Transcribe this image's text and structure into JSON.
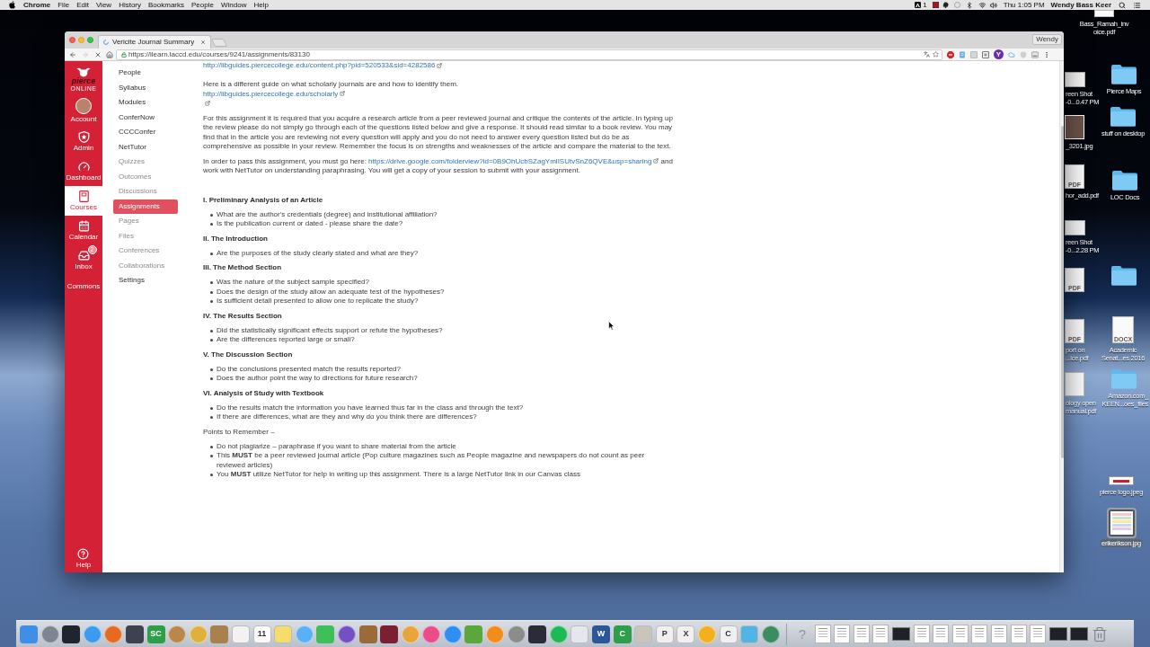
{
  "menu_bar": {
    "app": "Chrome",
    "menus": [
      "File",
      "Edit",
      "View",
      "History",
      "Bookmarks",
      "People",
      "Window",
      "Help"
    ],
    "status_count": "1",
    "clock": "Thu 1:05 PM",
    "user": "Wendy Bass Keer"
  },
  "browser": {
    "tab_title": "Vericite Journal Summary",
    "profile": "Wendy",
    "back": {
      "disabled": false
    },
    "forward": {
      "disabled": true
    },
    "url": "https://ilearn.laccd.edu/courses/9241/assignments/83130",
    "extension_letter": "Y"
  },
  "global_nav": {
    "logo": {
      "name": "pierce",
      "tagline": "ONLINE"
    },
    "items": [
      {
        "kind": "account",
        "label": "Account",
        "selected": false
      },
      {
        "kind": "admin",
        "label": "Admin",
        "selected": false
      },
      {
        "kind": "dashboard",
        "label": "Dashboard",
        "selected": false
      },
      {
        "kind": "courses",
        "label": "Courses",
        "selected": true
      },
      {
        "kind": "calendar",
        "label": "Calendar",
        "selected": false
      },
      {
        "kind": "inbox",
        "label": "Inbox",
        "selected": false,
        "badge": "2"
      },
      {
        "kind": "commons",
        "label": "Commons",
        "selected": false
      }
    ],
    "help": "Help"
  },
  "course_nav": {
    "items": [
      {
        "label": "People",
        "disabled": false,
        "selected": false
      },
      {
        "label": "Syllabus",
        "disabled": false,
        "selected": false
      },
      {
        "label": "Modules",
        "disabled": false,
        "selected": false
      },
      {
        "label": "ConferNow",
        "disabled": false,
        "selected": false
      },
      {
        "label": "CCCConfer",
        "disabled": false,
        "selected": false
      },
      {
        "label": "NetTutor",
        "disabled": false,
        "selected": false
      },
      {
        "label": "Quizzes",
        "disabled": true,
        "selected": false
      },
      {
        "label": "Outcomes",
        "disabled": true,
        "selected": false
      },
      {
        "label": "Discussions",
        "disabled": true,
        "selected": false
      },
      {
        "label": "Assignments",
        "disabled": false,
        "selected": true
      },
      {
        "label": "Pages",
        "disabled": true,
        "selected": false
      },
      {
        "label": "Files",
        "disabled": true,
        "selected": false
      },
      {
        "label": "Conferences",
        "disabled": true,
        "selected": false
      },
      {
        "label": "Collaborations",
        "disabled": true,
        "selected": false
      },
      {
        "label": "Settings",
        "disabled": false,
        "selected": false
      }
    ]
  },
  "content": {
    "blocks": [
      {
        "kind": "link",
        "link": "http://libguides.piercecollege.edu/content.php?pid=520533&sid=4282586"
      },
      {
        "kind": "text",
        "text": "Here is a different guide on what scholarly journals are and how to identify them."
      },
      {
        "kind": "link",
        "link": "http://libguides.piercecollege.edu/scholarly"
      },
      {
        "kind": "icon_line"
      },
      {
        "kind": "paragraph",
        "parts": [
          {
            "text": "For this assignment it is required that you acquire a research article from a peer reviewed journal and critique the contents of the article. In typing up the review please do not simply go through each of the questions listed below and give a response. It should read similar to a book review. You may find that in the article you are reviewing not every question will apply and you do not need to answer every question listed but do be as comprehensive as possible in your review. Remember the focus is on strengths and weaknesses of the article and compare the material to the text."
          }
        ]
      },
      {
        "kind": "paragraph",
        "parts": [
          {
            "text": "In order to pass this assignment, you must go here: "
          },
          {
            "link": "https://drive.google.com/folderview?id=0B9OhUcbSZagYmlISUtvSnZ6QVE&usp=sharing"
          },
          {
            "text": " and work with NetTutor on understanding paraphrasing. You will get a copy of your session to submit with your assignment."
          }
        ]
      },
      {
        "kind": "heading",
        "text": "I. Preliminary Analysis of an Article"
      },
      {
        "kind": "list",
        "items": [
          "What are the author's credentials (degree) and institutional affiliation?",
          "Is the publication current or dated - please share the date?"
        ]
      },
      {
        "kind": "heading",
        "text": "II. The Introduction"
      },
      {
        "kind": "list",
        "items": [
          "Are the purposes of the study clearly stated and what are they?"
        ]
      },
      {
        "kind": "heading",
        "text": "III. The Method Section"
      },
      {
        "kind": "list",
        "items": [
          "Was the nature of the subject sample specified?",
          "Does the design of the study allow an adequate test of the hypotheses?",
          "Is sufficient detail presented to allow one to replicate the study?"
        ]
      },
      {
        "kind": "heading",
        "text": "IV. The Results Section"
      },
      {
        "kind": "list",
        "items": [
          "Did the statistically significant effects support or refute the hypotheses?",
          "Are the differences reported large or small?"
        ]
      },
      {
        "kind": "heading",
        "text": "V. The Discussion Section"
      },
      {
        "kind": "list",
        "items": [
          "Do the conclusions presented match the results reported?",
          "Does the author point the way to directions for future research?"
        ]
      },
      {
        "kind": "heading",
        "text": "VI. Analysis of Study with Textbook"
      },
      {
        "kind": "list",
        "items": [
          "Do the results match the information you have learned thus far in the class and through the text?",
          "If there are differences, what are they and why do you think there are differences?"
        ]
      },
      {
        "kind": "paragraph",
        "parts": [
          {
            "text": "Points to Remember –"
          }
        ]
      },
      {
        "kind": "list",
        "items": [
          "Do not plagiarize – paraphrase if you want to share material from the article",
          "This **MUST** be a peer reviewed journal article (Pop culture magazines such as People magazine and newspapers do not count as peer reviewed articles)",
          "You **MUST** utilize NetTutor for help in writing up this assignment. There is a large NetTutor link in our Canvas class"
        ]
      }
    ]
  },
  "desktop_icons": [
    {
      "kind": "pdf",
      "label": [
        "Bass_Ramah_inv",
        "oice.pdf"
      ],
      "selected": false
    },
    {
      "kind": "screenshot",
      "label": [
        "reen Shot",
        "-0...0.47 PM"
      ],
      "selected": false
    },
    {
      "kind": "folder",
      "label": [
        "Pierce Maps"
      ],
      "selected": false
    },
    {
      "kind": "photo",
      "label": [
        "_3201.jpg"
      ],
      "selected": false
    },
    {
      "kind": "folder",
      "label": [
        "stuff on desktop"
      ],
      "selected": false
    },
    {
      "kind": "pdf",
      "tag": "PDF",
      "label": [
        "hor_add.pdf"
      ],
      "selected": false
    },
    {
      "kind": "folder",
      "label": [
        "LOC Docs"
      ],
      "selected": false
    },
    {
      "kind": "screenshot",
      "label": [
        "reen Shot",
        "-0...2.28 PM"
      ],
      "selected": false
    },
    {
      "kind": "pdf",
      "tag": "PDF",
      "selected": false
    },
    {
      "kind": "folder",
      "selected": false
    },
    {
      "kind": "pdf",
      "tag": "PDF",
      "label": [
        "port on",
        "...ice.pdf"
      ],
      "selected": false
    },
    {
      "kind": "docx",
      "tag": "DOCX",
      "label": [
        "Academic",
        "Senat...es 2016"
      ],
      "selected": false
    },
    {
      "kind": "pdf",
      "label": [
        "ology open",
        "manual.pdf"
      ],
      "selected": false
    },
    {
      "kind": "folder",
      "label": [
        "Amazon.com_",
        "KEEN...oes_files"
      ],
      "selected": false
    },
    {
      "kind": "banner",
      "label": [
        "pierce logo.jpeg"
      ],
      "selected": false
    },
    {
      "kind": "sheet",
      "label": [
        "erikerikson.jpg"
      ],
      "selected": true
    }
  ],
  "dock": [
    {
      "kind": "tile",
      "color": "#3f8fe6"
    },
    {
      "kind": "disc",
      "color": "#7d8592"
    },
    {
      "kind": "tile",
      "color": "#1f2530"
    },
    {
      "kind": "disc",
      "color": "#3b9bf0"
    },
    {
      "kind": "disc",
      "color": "#e66a1f"
    },
    {
      "kind": "tile",
      "color": "#3d4252"
    },
    {
      "kind": "tile",
      "color": "#2e9e48",
      "letter": "SC"
    },
    {
      "kind": "disc",
      "color": "#b9874a"
    },
    {
      "kind": "disc",
      "color": "#e0b13a"
    },
    {
      "kind": "tile",
      "color": "#a8814f"
    },
    {
      "kind": "tile",
      "color": "#f2f2f2"
    },
    {
      "kind": "tile",
      "color": "#fafafa",
      "letter": "11"
    },
    {
      "kind": "tile",
      "color": "#f6dc6a"
    },
    {
      "kind": "disc",
      "color": "#5ab0f5"
    },
    {
      "kind": "tile",
      "color": "#3fbf5a"
    },
    {
      "kind": "disc",
      "color": "#7550c2"
    },
    {
      "kind": "tile",
      "color": "#9a6a3a"
    },
    {
      "kind": "tile",
      "color": "#7a2030"
    },
    {
      "kind": "disc",
      "color": "#e9a43c"
    },
    {
      "kind": "disc",
      "color": "#ea4c89"
    },
    {
      "kind": "disc",
      "color": "#2f8ef2"
    },
    {
      "kind": "tile",
      "color": "#5aa83c"
    },
    {
      "kind": "disc",
      "color": "#f28c1c"
    },
    {
      "kind": "disc",
      "color": "#8c8c8c"
    },
    {
      "kind": "tile",
      "color": "#2b2b3a"
    },
    {
      "kind": "disc",
      "color": "#1db954"
    },
    {
      "kind": "tile",
      "color": "#e4e8ee"
    },
    {
      "kind": "tile",
      "color": "#2b579a",
      "letter": "W"
    },
    {
      "kind": "tile",
      "color": "#2f9e4a",
      "letter": "C"
    },
    {
      "kind": "tile",
      "color": "#c9c4bc"
    },
    {
      "kind": "tile",
      "color": "#f0f0f0",
      "letter": "P"
    },
    {
      "kind": "tile",
      "color": "#f0f0f0",
      "letter": "X"
    },
    {
      "kind": "disc",
      "color": "#f2b01e"
    },
    {
      "kind": "tile",
      "color": "#f0f0f0",
      "letter": "C"
    },
    {
      "kind": "tile",
      "color": "#50b4e4"
    },
    {
      "kind": "disc",
      "color": "#3c8c62"
    },
    {
      "kind": "glyph",
      "letter": "?"
    },
    {
      "kind": "doc"
    },
    {
      "kind": "doc"
    },
    {
      "kind": "doc"
    },
    {
      "kind": "doc"
    },
    {
      "kind": "thumb"
    },
    {
      "kind": "doc"
    },
    {
      "kind": "doc"
    },
    {
      "kind": "doc"
    },
    {
      "kind": "doc"
    },
    {
      "kind": "doc"
    },
    {
      "kind": "doc"
    },
    {
      "kind": "doc"
    },
    {
      "kind": "thumb"
    },
    {
      "kind": "thumb"
    },
    {
      "kind": "trash"
    }
  ]
}
